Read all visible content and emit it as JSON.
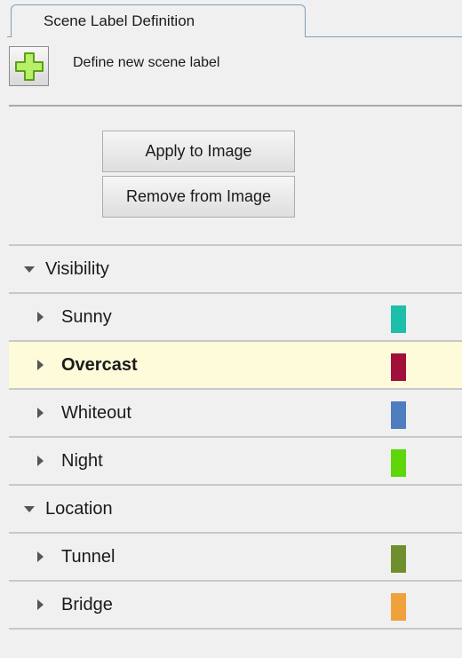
{
  "tab": {
    "title": "Scene Label Definition"
  },
  "toolbar": {
    "add_label": "Define new scene label"
  },
  "actions": {
    "apply_label": "Apply to Image",
    "remove_label": "Remove from Image"
  },
  "groups": [
    {
      "label": "Visibility",
      "items": [
        {
          "label": "Sunny",
          "color": "#1dbfaa",
          "selected": false
        },
        {
          "label": "Overcast",
          "color": "#a0103a",
          "selected": true
        },
        {
          "label": "Whiteout",
          "color": "#4f7dbf",
          "selected": false
        },
        {
          "label": "Night",
          "color": "#5ed60a",
          "selected": false
        }
      ]
    },
    {
      "label": "Location",
      "items": [
        {
          "label": "Tunnel",
          "color": "#6f8f2f",
          "selected": false
        },
        {
          "label": "Bridge",
          "color": "#f0a13b",
          "selected": false
        }
      ]
    }
  ],
  "icons": {
    "add": "plus-icon",
    "expanded": "triangle-down-icon",
    "collapsed": "triangle-right-icon"
  },
  "colors": {
    "selected_row": "#fdfbd9",
    "plus_fill": "#b6f069",
    "plus_stroke": "#5d9e17"
  }
}
